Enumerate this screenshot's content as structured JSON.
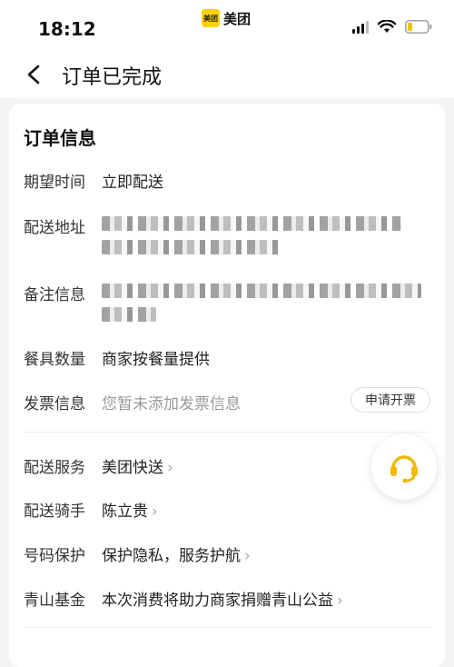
{
  "status": {
    "time": "18:12",
    "brand_box": "美团",
    "brand": "美团"
  },
  "nav": {
    "title": "订单已完成"
  },
  "card": {
    "title": "订单信息",
    "rows": {
      "expected_time": {
        "label": "期望时间",
        "value": "立即配送"
      },
      "address": {
        "label": "配送地址"
      },
      "remark": {
        "label": "备注信息"
      },
      "tableware": {
        "label": "餐具数量",
        "value": "商家按餐量提供"
      },
      "invoice": {
        "label": "发票信息",
        "value": "您暂未添加发票信息",
        "button": "申请开票"
      },
      "delivery_service": {
        "label": "配送服务",
        "value": "美团快送"
      },
      "rider": {
        "label": "配送骑手",
        "value": "陈立贵"
      },
      "number_protect": {
        "label": "号码保护",
        "value": "保护隐私，服务护航"
      },
      "fund": {
        "label": "青山基金",
        "value": "本次消费将助力商家捐赠青山公益"
      }
    }
  },
  "colors": {
    "accent": "#ffd100",
    "support_icon": "#f5b800"
  }
}
